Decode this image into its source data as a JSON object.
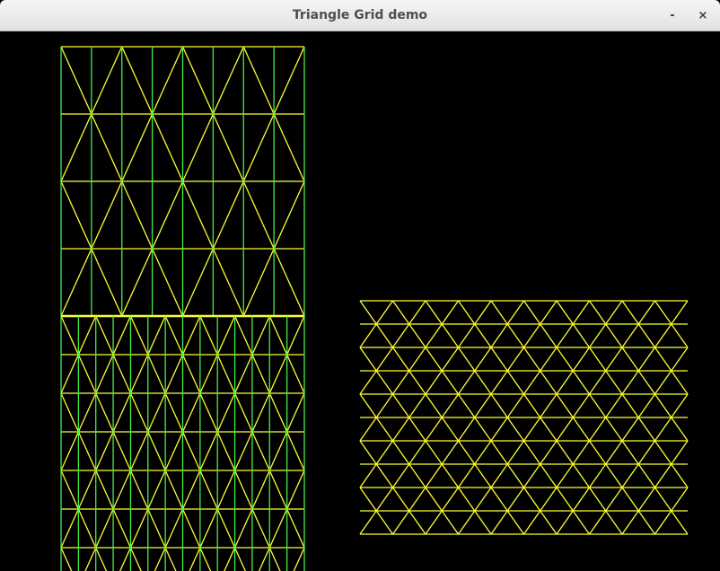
{
  "window": {
    "title": "Triangle Grid demo",
    "minimize_glyph": "-",
    "close_glyph": "×"
  },
  "colors": {
    "background": "#000000",
    "triangle_edges": "#ffff33",
    "vertical_edges": "#44ee44"
  },
  "icons": {
    "minimize": "minimize-icon",
    "close": "close-icon"
  }
}
